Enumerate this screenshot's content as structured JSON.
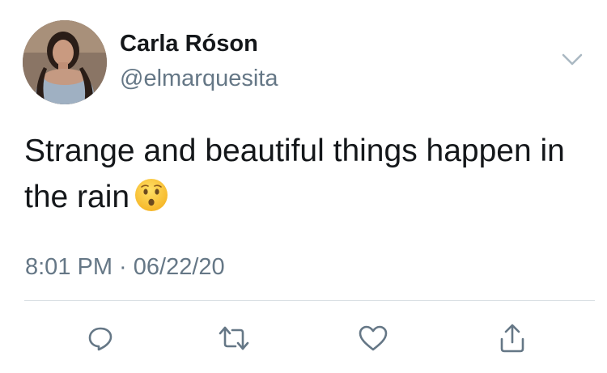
{
  "tweet": {
    "display_name": "Carla Róson",
    "handle": "@elmarquesita",
    "text_line1": "Strange and beautiful things happen in",
    "text_line2": "the rain",
    "emoji": "hushed-face-emoji",
    "timestamp": "8:01 PM · 06/22/20"
  },
  "icons": {
    "caret": "chevron-down-icon",
    "reply": "reply-icon",
    "retweet": "retweet-icon",
    "like": "heart-icon",
    "share": "share-icon"
  },
  "colors": {
    "text": "#14171a",
    "secondary": "#657786",
    "divider": "#d9dfe3"
  }
}
